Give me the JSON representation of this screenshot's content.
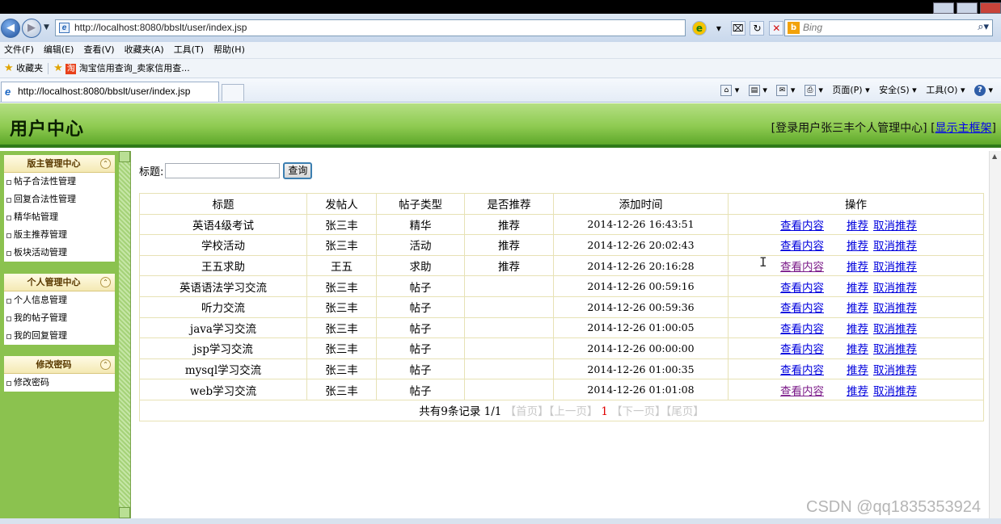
{
  "browser": {
    "url": "http://localhost:8080/bbslt/user/index.jsp",
    "tab_title": "http://localhost:8080/bbslt/user/index.jsp",
    "search_placeholder": "Bing",
    "menu": [
      "文件(F)",
      "编辑(E)",
      "查看(V)",
      "收藏夹(A)",
      "工具(T)",
      "帮助(H)"
    ],
    "favorites_label": "收藏夹",
    "favorite_link": "淘宝信用查询_卖家信用查...",
    "commands": {
      "page": "页面(P) ▾",
      "safety": "安全(S) ▾",
      "tools": "工具(O) ▾"
    }
  },
  "header": {
    "title": "用户中心",
    "status_prefix": "[登录用户张三丰个人管理中心]",
    "bracket_open": "[",
    "frame_link": "显示主框架",
    "bracket_close": "]"
  },
  "sidebar": {
    "sections": [
      {
        "title": "版主管理中心",
        "items": [
          "帖子合法性管理",
          "回复合法性管理",
          "精华帖管理",
          "版主推荐管理",
          "板块活动管理"
        ]
      },
      {
        "title": "个人管理中心",
        "items": [
          "个人信息管理",
          "我的帖子管理",
          "我的回复管理"
        ]
      },
      {
        "title": "修改密码",
        "items": [
          "修改密码"
        ]
      }
    ]
  },
  "search": {
    "label": "标题:",
    "value": "",
    "button": "查询"
  },
  "table": {
    "headers": [
      "标题",
      "发帖人",
      "帖子类型",
      "是否推荐",
      "添加时间",
      "操作"
    ],
    "rows": [
      {
        "title": "英语4级考试",
        "author": "张三丰",
        "type": "精华",
        "recommended": "推荐",
        "time": "2014-12-26 16:43:51"
      },
      {
        "title": "学校活动",
        "author": "张三丰",
        "type": "活动",
        "recommended": "推荐",
        "time": "2014-12-26 20:02:43"
      },
      {
        "title": "王五求助",
        "author": "王五",
        "type": "求助",
        "recommended": "推荐",
        "time": "2014-12-26 20:16:28"
      },
      {
        "title": "英语语法学习交流",
        "author": "张三丰",
        "type": "帖子",
        "recommended": "",
        "time": "2014-12-26 00:59:16"
      },
      {
        "title": "听力交流",
        "author": "张三丰",
        "type": "帖子",
        "recommended": "",
        "time": "2014-12-26 00:59:36"
      },
      {
        "title": "java学习交流",
        "author": "张三丰",
        "type": "帖子",
        "recommended": "",
        "time": "2014-12-26 01:00:05"
      },
      {
        "title": "jsp学习交流",
        "author": "张三丰",
        "type": "帖子",
        "recommended": "",
        "time": "2014-12-26 00:00:00"
      },
      {
        "title": "mysql学习交流",
        "author": "张三丰",
        "type": "帖子",
        "recommended": "",
        "time": "2014-12-26 01:00:35"
      },
      {
        "title": "web学习交流",
        "author": "张三丰",
        "type": "帖子",
        "recommended": "",
        "time": "2014-12-26 01:01:08"
      }
    ],
    "actions": {
      "view": "查看内容",
      "recommend": "推荐",
      "cancel": "取消推荐"
    }
  },
  "pager": {
    "summary": "共有9条记录",
    "page_info": "1/1",
    "first": "【首页】",
    "prev": "【上一页】",
    "current": "1",
    "next": "【下一页】",
    "last": "【尾页】"
  },
  "watermark": "CSDN @qq1835353924",
  "colors": {
    "header_green": "#8fcb52",
    "sidebar_green": "#8bc24f",
    "link": "#0000dd",
    "visited_link": "#7c1c8a",
    "current_page": "#e00000"
  }
}
